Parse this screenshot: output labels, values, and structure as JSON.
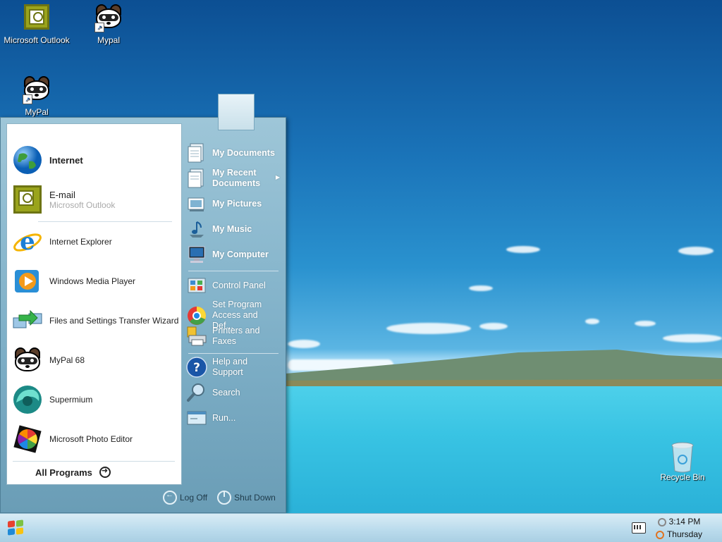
{
  "desktop": {
    "icons": [
      {
        "label": "Microsoft Outlook"
      },
      {
        "label": "Mypal"
      },
      {
        "label": "MyPal"
      },
      {
        "label": "Recycle Bin"
      }
    ]
  },
  "start_menu": {
    "pinned": [
      {
        "title": "Internet",
        "subtitle": "",
        "icon": "globe-icon"
      },
      {
        "title": "E-mail",
        "subtitle": "Microsoft Outlook",
        "icon": "outlook-icon"
      }
    ],
    "recent": [
      {
        "label": "Internet Explorer",
        "icon": "internet-explorer-icon"
      },
      {
        "label": "Windows Media Player",
        "icon": "media-player-icon"
      },
      {
        "label": "Files and Settings Transfer Wizard",
        "icon": "transfer-wizard-icon"
      },
      {
        "label": "MyPal 68",
        "icon": "mypal-icon"
      },
      {
        "label": "Supermium",
        "icon": "supermium-icon"
      },
      {
        "label": "Microsoft Photo Editor",
        "icon": "photo-editor-icon"
      }
    ],
    "all_programs": "All Programs",
    "places": [
      {
        "label": "My Documents",
        "icon": "documents-icon"
      },
      {
        "label": "My Recent Documents",
        "icon": "recent-documents-icon"
      },
      {
        "label": "My Pictures",
        "icon": "pictures-icon"
      },
      {
        "label": "My Music",
        "icon": "music-icon"
      },
      {
        "label": "My Computer",
        "icon": "computer-icon"
      }
    ],
    "system": [
      {
        "label": "Control Panel",
        "icon": "control-panel-icon"
      },
      {
        "label": "Set Program Access and Def...",
        "icon": "program-access-icon"
      },
      {
        "label": "Printers and Faxes",
        "icon": "printer-icon"
      }
    ],
    "support": [
      {
        "label": "Help and Support",
        "icon": "help-icon"
      },
      {
        "label": "Search",
        "icon": "search-icon"
      },
      {
        "label": "Run...",
        "icon": "run-icon"
      }
    ],
    "log_off": "Log Off",
    "shut_down": "Shut Down"
  },
  "taskbar": {
    "time": "3:14 PM",
    "day": "Thursday"
  }
}
